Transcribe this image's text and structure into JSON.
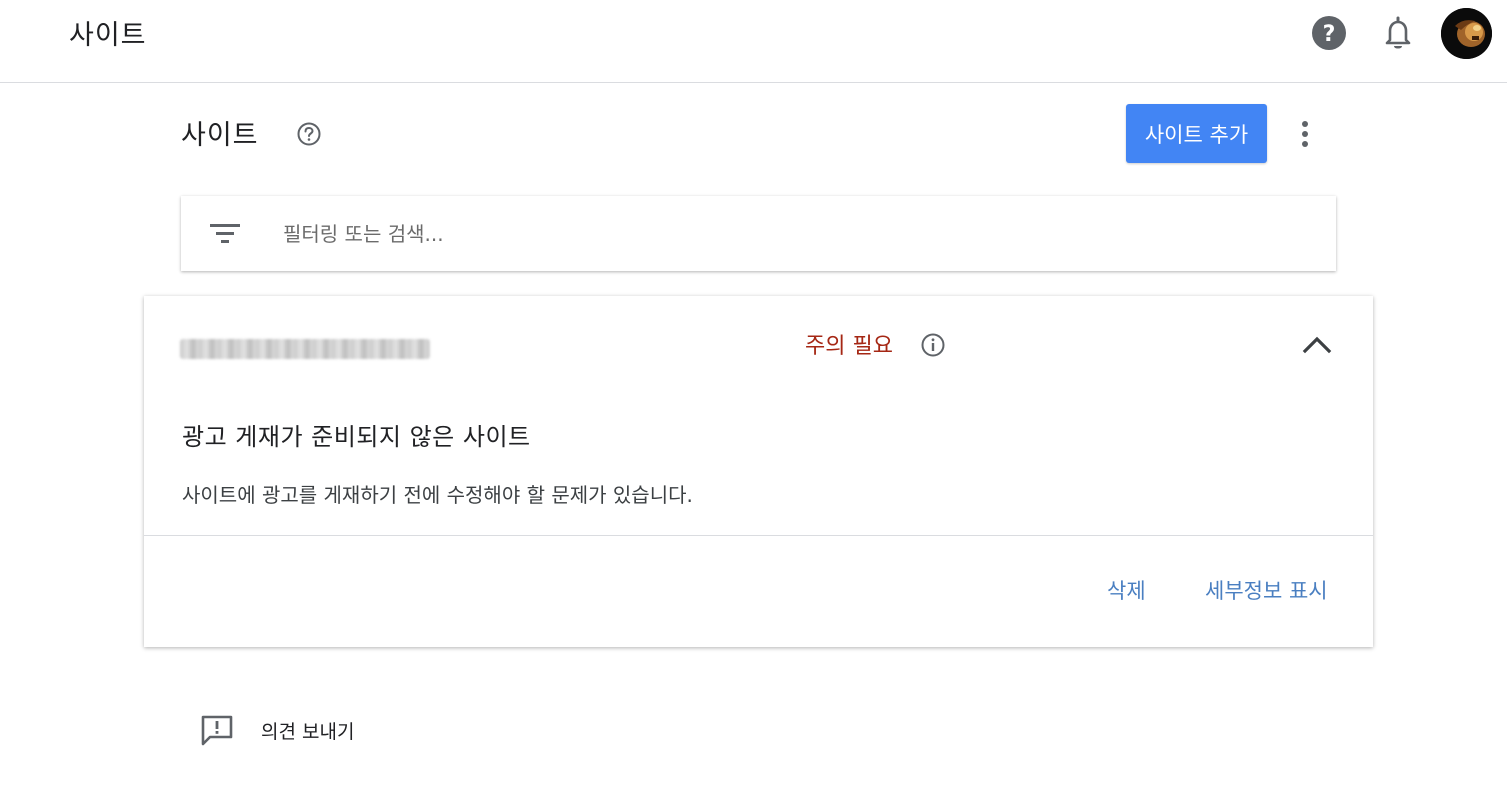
{
  "app_bar": {
    "title": "사이트",
    "help_icon": "help-circle-icon",
    "notifications_icon": "bell-icon",
    "avatar_icon": "user-avatar"
  },
  "page_header": {
    "title": "사이트",
    "help_icon": "help-outline-icon",
    "add_site_label": "사이트 추가",
    "more_icon": "more-vert-icon"
  },
  "filter": {
    "icon": "filter-list-icon",
    "placeholder": "필터링 또는 검색..."
  },
  "site_card": {
    "site_url": "",
    "status_label": "주의 필요",
    "status_color": "#a52714",
    "heading": "광고 게재가 준비되지 않은 사이트",
    "description": "사이트에 광고를 게재하기 전에 수정해야 할 문제가 있습니다.",
    "delete_label": "삭제",
    "details_label": "세부정보 표시",
    "link_color": "#4a7fc1"
  },
  "feedback": {
    "icon": "feedback-icon",
    "label": "의견 보내기"
  },
  "colors": {
    "primary": "#4285f4",
    "icon_gray": "#5f6368"
  }
}
